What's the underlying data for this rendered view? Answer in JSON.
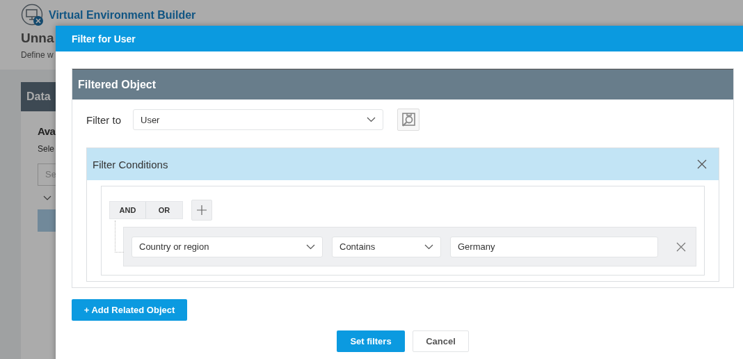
{
  "app": {
    "title": "Virtual Environment Builder",
    "page_title": "Unna",
    "page_subtitle": "Define w",
    "card_header": "Data",
    "card_title": "Ava",
    "card_text": "Sele",
    "search_placeholder": "Se"
  },
  "dialog": {
    "title": "Filter for User",
    "filtered_object": {
      "title": "Filtered Object",
      "filter_to_label": "Filter to",
      "filter_to_value": "User"
    },
    "conditions": {
      "title": "Filter Conditions",
      "operators": [
        "AND",
        "OR"
      ],
      "rows": [
        {
          "field": "Country or region",
          "operator": "Contains",
          "value": "Germany"
        }
      ]
    },
    "add_related_label": "+ Add Related Object",
    "buttons": [
      {
        "label": "Set filters",
        "kind": "primary"
      },
      {
        "label": "Cancel",
        "kind": "secondary"
      }
    ]
  }
}
